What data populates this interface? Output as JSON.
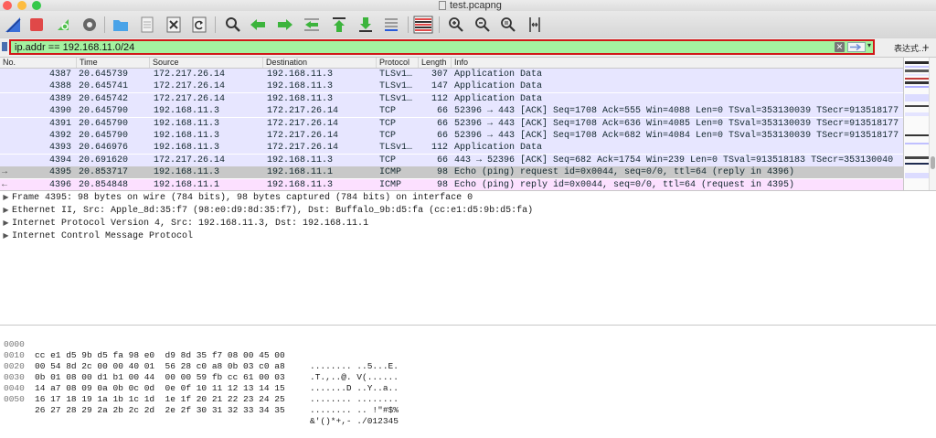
{
  "window": {
    "title": "test.pcapng",
    "traffic_lights": [
      "#fc605b",
      "#fdbc40",
      "#34c84a"
    ]
  },
  "toolbar": {
    "buttons": [
      {
        "name": "start-capture-icon"
      },
      {
        "name": "stop-capture-icon"
      },
      {
        "name": "restart-capture-icon"
      },
      {
        "name": "capture-options-icon"
      },
      {
        "name": "open-file-icon"
      },
      {
        "name": "save-file-icon"
      },
      {
        "name": "close-file-icon"
      },
      {
        "name": "reload-file-icon"
      },
      {
        "name": "find-packet-icon"
      },
      {
        "name": "go-back-icon"
      },
      {
        "name": "go-forward-icon"
      },
      {
        "name": "go-to-packet-icon"
      },
      {
        "name": "go-first-icon"
      },
      {
        "name": "go-last-icon"
      },
      {
        "name": "autoscroll-icon"
      },
      {
        "name": "colorize-icon"
      },
      {
        "name": "zoom-in-icon"
      },
      {
        "name": "zoom-out-icon"
      },
      {
        "name": "zoom-normal-icon"
      },
      {
        "name": "resize-columns-icon"
      }
    ]
  },
  "filter": {
    "value": "ip.addr == 192.168.11.0/24",
    "expression_label": "表达式…",
    "plus_label": "+",
    "background": "#a4f2a0",
    "highlight_border": "#d01818"
  },
  "packet_list": {
    "columns": [
      "No.",
      "Time",
      "Source",
      "Destination",
      "Protocol",
      "Length",
      "Info"
    ],
    "rows": [
      {
        "no": "4387",
        "time": "20.645739",
        "src": "172.217.26.14",
        "dst": "192.168.11.3",
        "proto": "TLSv1…",
        "len": "307",
        "info": "Application Data",
        "bg": "#e7e6ff",
        "fg": "#12272e",
        "marker": ""
      },
      {
        "no": "4388",
        "time": "20.645741",
        "src": "172.217.26.14",
        "dst": "192.168.11.3",
        "proto": "TLSv1…",
        "len": "147",
        "info": "Application Data",
        "bg": "#e7e6ff",
        "fg": "#12272e",
        "marker": ""
      },
      {
        "no": "4389",
        "time": "20.645742",
        "src": "172.217.26.14",
        "dst": "192.168.11.3",
        "proto": "TLSv1…",
        "len": "112",
        "info": "Application Data",
        "bg": "#e7e6ff",
        "fg": "#12272e",
        "marker": ""
      },
      {
        "no": "4390",
        "time": "20.645790",
        "src": "192.168.11.3",
        "dst": "172.217.26.14",
        "proto": "TCP",
        "len": "66",
        "info": "52396 → 443 [ACK] Seq=1708 Ack=555 Win=4088 Len=0 TSval=353130039 TSecr=913518177",
        "bg": "#e7e6ff",
        "fg": "#12272e",
        "marker": ""
      },
      {
        "no": "4391",
        "time": "20.645790",
        "src": "192.168.11.3",
        "dst": "172.217.26.14",
        "proto": "TCP",
        "len": "66",
        "info": "52396 → 443 [ACK] Seq=1708 Ack=636 Win=4085 Len=0 TSval=353130039 TSecr=913518177",
        "bg": "#e7e6ff",
        "fg": "#12272e",
        "marker": ""
      },
      {
        "no": "4392",
        "time": "20.645790",
        "src": "192.168.11.3",
        "dst": "172.217.26.14",
        "proto": "TCP",
        "len": "66",
        "info": "52396 → 443 [ACK] Seq=1708 Ack=682 Win=4084 Len=0 TSval=353130039 TSecr=913518177",
        "bg": "#e7e6ff",
        "fg": "#12272e",
        "marker": ""
      },
      {
        "no": "4393",
        "time": "20.646976",
        "src": "192.168.11.3",
        "dst": "172.217.26.14",
        "proto": "TLSv1…",
        "len": "112",
        "info": "Application Data",
        "bg": "#e7e6ff",
        "fg": "#12272e",
        "marker": ""
      },
      {
        "no": "4394",
        "time": "20.691620",
        "src": "172.217.26.14",
        "dst": "192.168.11.3",
        "proto": "TCP",
        "len": "66",
        "info": "443 → 52396 [ACK] Seq=682 Ack=1754 Win=239 Len=0 TSval=913518183 TSecr=353130040",
        "bg": "#e7e6ff",
        "fg": "#12272e",
        "marker": ""
      },
      {
        "no": "4395",
        "time": "20.853717",
        "src": "192.168.11.3",
        "dst": "192.168.11.1",
        "proto": "ICMP",
        "len": "98",
        "info": "Echo (ping) request  id=0x0044, seq=0/0, ttl=64 (reply in 4396)",
        "bg": "#c8c8c8",
        "fg": "#12272e",
        "marker": "→"
      },
      {
        "no": "4396",
        "time": "20.854848",
        "src": "192.168.11.1",
        "dst": "192.168.11.3",
        "proto": "ICMP",
        "len": "98",
        "info": "Echo (ping) reply    id=0x0044, seq=0/0, ttl=64 (request in 4395)",
        "bg": "#fce0ff",
        "fg": "#12272e",
        "marker": "←"
      }
    ]
  },
  "details": {
    "items": [
      "Frame 4395: 98 bytes on wire (784 bits), 98 bytes captured (784 bits) on interface 0",
      "Ethernet II, Src: Apple_8d:35:f7 (98:e0:d9:8d:35:f7), Dst: Buffalo_9b:d5:fa (cc:e1:d5:9b:d5:fa)",
      "Internet Protocol Version 4, Src: 192.168.11.3, Dst: 192.168.11.1",
      "Internet Control Message Protocol"
    ]
  },
  "hex_dump": {
    "rows": [
      {
        "offset": "0000",
        "bytes": "cc e1 d5 9b d5 fa 98 e0  d9 8d 35 f7 08 00 45 00",
        "ascii": "........ ..5...E."
      },
      {
        "offset": "0010",
        "bytes": "00 54 8d 2c 00 00 40 01  56 28 c0 a8 0b 03 c0 a8",
        "ascii": ".T.,..@. V(......"
      },
      {
        "offset": "0020",
        "bytes": "0b 01 08 00 d1 b1 00 44  00 00 59 fb cc 61 00 03",
        "ascii": ".......D ..Y..a.."
      },
      {
        "offset": "0030",
        "bytes": "14 a7 08 09 0a 0b 0c 0d  0e 0f 10 11 12 13 14 15",
        "ascii": "........ ........"
      },
      {
        "offset": "0040",
        "bytes": "16 17 18 19 1a 1b 1c 1d  1e 1f 20 21 22 23 24 25",
        "ascii": "........ .. !\"#$%"
      },
      {
        "offset": "0050",
        "bytes": "26 27 28 29 2a 2b 2c 2d  2e 2f 30 31 32 33 34 35",
        "ascii": "&'()*+,- ./012345"
      }
    ]
  }
}
